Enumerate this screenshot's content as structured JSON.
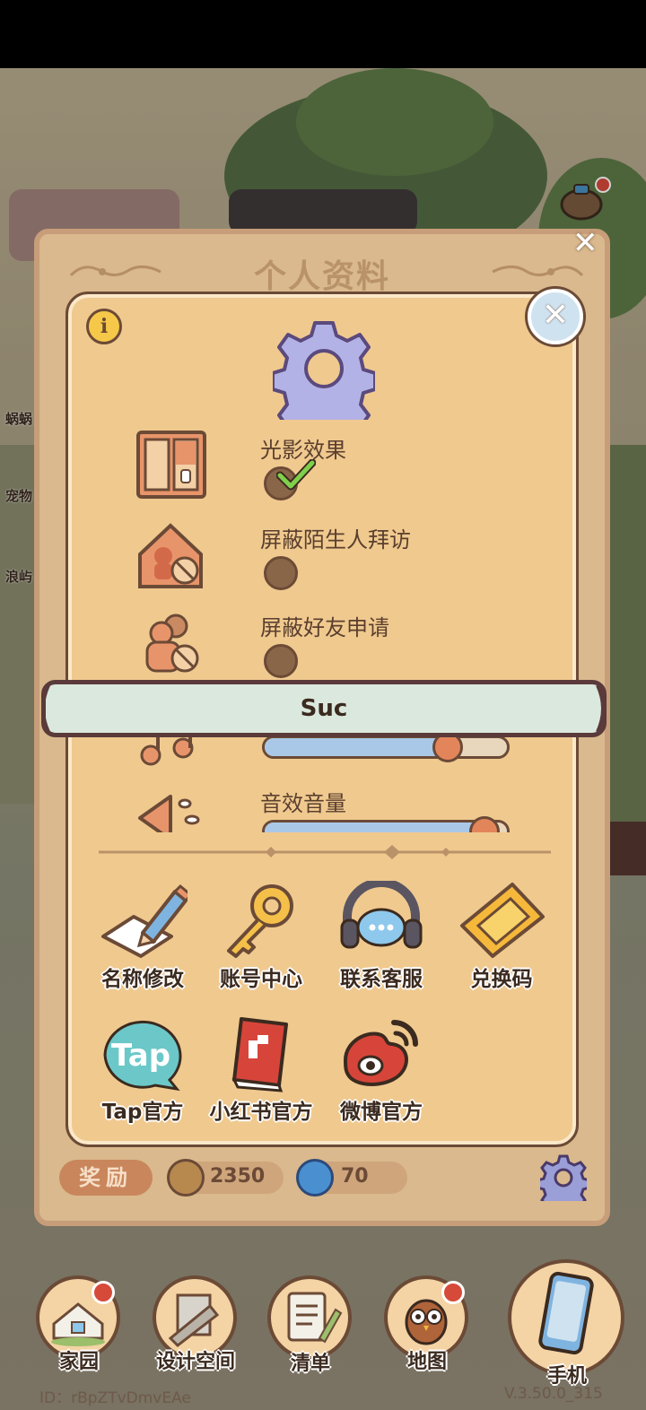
{
  "background": {
    "side_labels": [
      "蜗蜗",
      "宠物",
      "浪屿"
    ]
  },
  "profile_panel": {
    "title": "个人资料",
    "close_symbol": "✕",
    "reward_label": "奖励",
    "coins": "2350",
    "gems": "70"
  },
  "settings": {
    "info_symbol": "i",
    "close_symbol": "✕",
    "toggles": [
      {
        "label": "光影效果",
        "checked": true,
        "icon": "window-icon"
      },
      {
        "label": "屏蔽陌生人拜访",
        "checked": false,
        "icon": "house-block-icon"
      },
      {
        "label": "屏蔽好友申请",
        "checked": false,
        "icon": "friends-block-icon"
      }
    ],
    "sliders": [
      {
        "icon": "music-note-icon",
        "value": 0.75
      },
      {
        "label": "音效音量",
        "icon": "speaker-icon",
        "value": 0.9
      }
    ],
    "actions": [
      {
        "label": "名称修改",
        "icon": "pencil-icon"
      },
      {
        "label": "账号中心",
        "icon": "key-icon"
      },
      {
        "label": "联系客服",
        "icon": "headset-icon"
      },
      {
        "label": "兑换码",
        "icon": "ticket-icon"
      }
    ],
    "links": [
      {
        "label": "Tap官方",
        "icon": "tap-icon",
        "icon_text": "Tap"
      },
      {
        "label": "小红书官方",
        "icon": "red-book-icon"
      },
      {
        "label": "微博官方",
        "icon": "weibo-icon"
      }
    ]
  },
  "toast": {
    "text": "Suc"
  },
  "bottom_nav": {
    "items": [
      {
        "label": "家园",
        "icon": "home-icon",
        "badge": true
      },
      {
        "label": "设计空间",
        "icon": "design-space-icon",
        "badge": false
      },
      {
        "label": "清单",
        "icon": "list-icon",
        "badge": false
      },
      {
        "label": "地图",
        "icon": "map-icon",
        "badge": true
      },
      {
        "label": "手机",
        "icon": "phone-icon",
        "badge": false
      }
    ],
    "user_id": "ID：rBpZTvDmvEAe",
    "version": "V.3.50.0_315"
  },
  "colors": {
    "dialog_fill": "#f0c98f",
    "dialog_border": "#fbe8c8",
    "panel_fill": "#d9b98d",
    "panel_border": "#c79e79",
    "text_brown": "#6b4a36",
    "toggle_dot": "#8a6648",
    "check": "#5cb83a",
    "slider_fill": "#a9c8e8",
    "slider_knob": "#e3855b",
    "toast_fill": "#dbe8dd",
    "reward_badge": "#c9865c"
  }
}
